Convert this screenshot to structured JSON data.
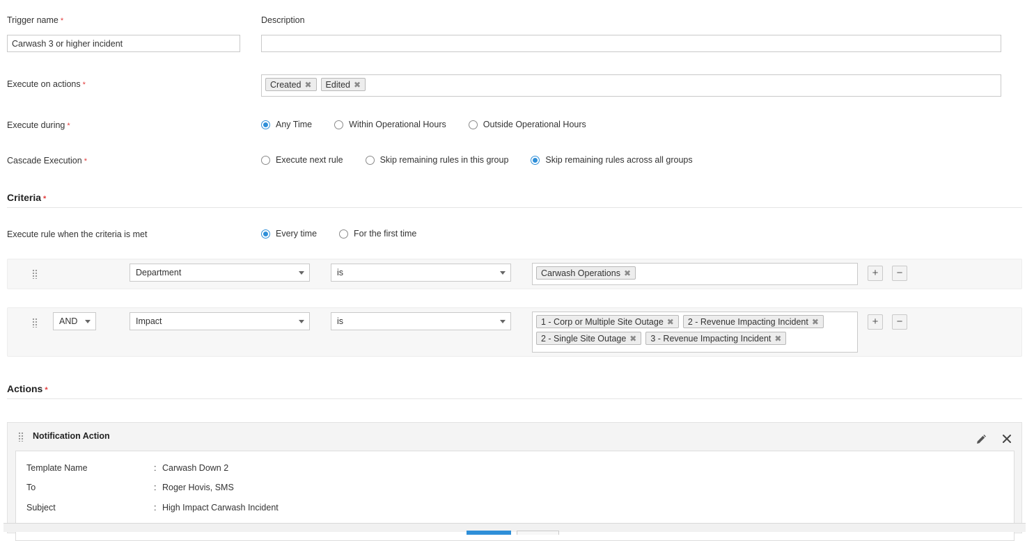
{
  "trigger_name": {
    "label": "Trigger name",
    "value": "Carwash 3 or higher incident"
  },
  "description": {
    "label": "Description",
    "value": ""
  },
  "execute_on_actions": {
    "label": "Execute on actions",
    "tags": [
      "Created",
      "Edited"
    ]
  },
  "execute_during": {
    "label": "Execute during",
    "options": [
      "Any Time",
      "Within Operational Hours",
      "Outside Operational Hours"
    ],
    "selected_index": 0
  },
  "cascade_execution": {
    "label": "Cascade Execution",
    "options": [
      "Execute next rule",
      "Skip remaining rules in this group",
      "Skip remaining rules across all groups"
    ],
    "selected_index": 2
  },
  "criteria": {
    "title": "Criteria",
    "execute_when_label": "Execute rule when the criteria is met",
    "execute_when_options": [
      "Every time",
      "For the first time"
    ],
    "execute_when_selected_index": 0,
    "rows": [
      {
        "field": "Department",
        "operator": "is",
        "values": [
          "Carwash Operations"
        ]
      },
      {
        "joiner": "AND",
        "field": "Impact",
        "operator": "is",
        "values": [
          "1 - Corp or Multiple Site Outage",
          "2 - Revenue Impacting Incident",
          "2 - Single Site Outage",
          "3 - Revenue Impacting Incident"
        ]
      }
    ],
    "add_symbol": "+",
    "remove_symbol": "−"
  },
  "actions": {
    "title": "Actions",
    "notification": {
      "title": "Notification Action",
      "fields": [
        {
          "key": "Template Name",
          "value": "Carwash Down 2"
        },
        {
          "key": "To",
          "value": "Roger Hovis, SMS"
        },
        {
          "key": "Subject",
          "value": "High Impact Carwash Incident"
        }
      ],
      "separator": ":"
    }
  },
  "required_marker": "*",
  "tag_remove_symbol": "✖",
  "colors": {
    "accent": "#2f8fd8",
    "required": "#e23b3b",
    "save_button": "#2f8fd8"
  }
}
